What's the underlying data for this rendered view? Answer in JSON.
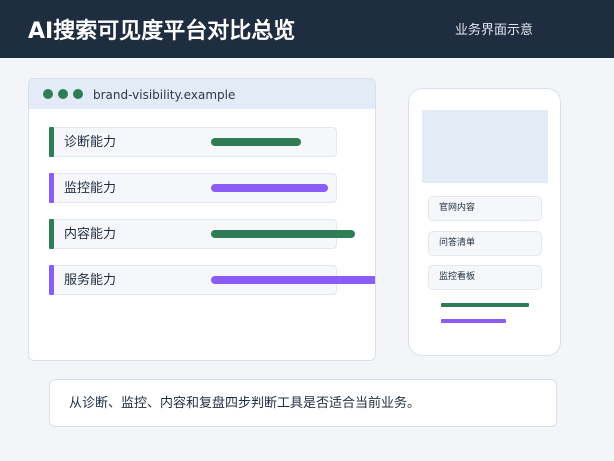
{
  "header": {
    "title": "AI搜索可见度平台对比总览",
    "subtitle": "业务界面示意"
  },
  "browser": {
    "url": "brand-visibility.example",
    "window_dots_color": "#2e7d56",
    "capabilities": [
      {
        "label": "诊断能力",
        "color": "#2e7d56",
        "level": 0.5
      },
      {
        "label": "监控能力",
        "color": "#8b5cf6",
        "level": 0.65
      },
      {
        "label": "内容能力",
        "color": "#2e7d56",
        "level": 0.8
      },
      {
        "label": "服务能力",
        "color": "#8b5cf6",
        "level": 0.95
      }
    ]
  },
  "phone": {
    "items": [
      {
        "label": "官网内容"
      },
      {
        "label": "问答清单"
      },
      {
        "label": "监控看板"
      }
    ],
    "lines": [
      {
        "color": "#2e7d56",
        "level": 0.88
      },
      {
        "color": "#8b5cf6",
        "level": 0.65
      }
    ]
  },
  "note": {
    "text": "从诊断、监控、内容和复盘四步判断工具是否适合当前业务。"
  },
  "colors": {
    "header_bg": "#1f2d40",
    "accent_green": "#2e7d56",
    "accent_purple": "#8b5cf6",
    "panel_bg": "#e3ecf6"
  }
}
